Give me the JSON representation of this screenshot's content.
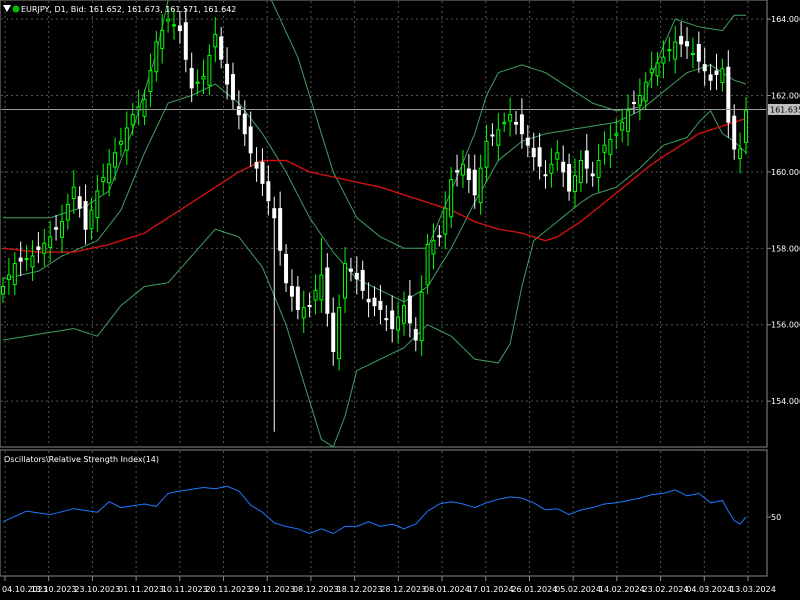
{
  "header": {
    "symbol_info": "EURJPY, D1, Bid:  161.652, 161.673, 161.571, 161.642",
    "triangle_icon": "triangle-down-icon",
    "status_icon": "green-dot-icon"
  },
  "colors": {
    "background": "#000000",
    "grid": "#4a5a52",
    "bull_candle": "#00ff00",
    "bear_candle": "#ffffff",
    "bollinger": "#3f9f5f",
    "moving_average": "#d01010",
    "rsi_line": "#1e78ff",
    "price_line": "#8a8a8a",
    "current_price_box": "#c0c0c0"
  },
  "rsi_panel": {
    "title": "Oscillators\\Relative Strength Index(14)",
    "level_label": "50"
  },
  "current_price": {
    "label": "161.635",
    "value": 161.635
  },
  "x_axis_labels": [
    "04.10.2023",
    "13.10.2023",
    "23.10.2023",
    "01.11.2023",
    "10.11.2023",
    "20.11.2023",
    "29.11.2023",
    "08.12.2023",
    "18.12.2023",
    "28.12.2023",
    "08.01.2024",
    "17.01.2024",
    "26.01.2024",
    "05.02.2024",
    "14.02.2024",
    "23.02.2024",
    "04.03.2024",
    "13.03.2024"
  ],
  "chart_data": [
    {
      "type": "candlestick",
      "title": "EURJPY, D1",
      "y_ticks": [
        154.0,
        156.0,
        158.0,
        160.0,
        162.0,
        164.0
      ],
      "ylim": [
        152.8,
        164.5
      ],
      "grid": true,
      "anchors": {
        "price": [
          [
            0,
            157.0
          ],
          [
            2,
            157.6
          ],
          [
            5,
            157.8
          ],
          [
            8,
            158.3
          ],
          [
            10,
            158.7
          ],
          [
            12,
            159.6
          ],
          [
            14,
            158.5
          ],
          [
            16,
            159.5
          ],
          [
            18,
            160.2
          ],
          [
            20,
            160.8
          ],
          [
            22,
            161.5
          ],
          [
            24,
            161.9
          ],
          [
            26,
            163.4
          ],
          [
            28,
            164.0
          ],
          [
            30,
            163.7
          ],
          [
            32,
            162.2
          ],
          [
            34,
            162.5
          ],
          [
            36,
            163.6
          ],
          [
            38,
            162.3
          ],
          [
            40,
            161.5
          ],
          [
            42,
            160.5
          ],
          [
            44,
            159.7
          ],
          [
            46,
            158.8
          ],
          [
            48,
            157.1
          ],
          [
            50,
            156.4
          ],
          [
            52,
            156.5
          ],
          [
            54,
            157.3
          ],
          [
            56,
            155.3
          ],
          [
            58,
            157.6
          ],
          [
            60,
            157.2
          ],
          [
            62,
            156.6
          ],
          [
            64,
            156.4
          ],
          [
            66,
            155.9
          ],
          [
            68,
            156.5
          ],
          [
            70,
            155.6
          ],
          [
            72,
            158.1
          ],
          [
            74,
            158.3
          ],
          [
            76,
            159.8
          ],
          [
            78,
            160.2
          ],
          [
            80,
            159.4
          ],
          [
            82,
            160.8
          ],
          [
            84,
            161.1
          ],
          [
            86,
            161.5
          ],
          [
            88,
            161.0
          ],
          [
            90,
            160.4
          ],
          [
            92,
            159.9
          ],
          [
            94,
            160.5
          ],
          [
            96,
            159.5
          ],
          [
            98,
            160.3
          ],
          [
            100,
            159.9
          ],
          [
            102,
            160.7
          ],
          [
            104,
            161.0
          ],
          [
            106,
            161.6
          ],
          [
            108,
            162.0
          ],
          [
            110,
            162.7
          ],
          [
            112,
            163.0
          ],
          [
            114,
            163.4
          ],
          [
            116,
            163.3
          ],
          [
            118,
            162.9
          ],
          [
            120,
            162.4
          ],
          [
            122,
            162.7
          ],
          [
            123,
            161.3
          ],
          [
            124,
            160.6
          ],
          [
            125,
            160.6
          ],
          [
            126,
            161.6
          ]
        ],
        "bollinger_upper": [
          [
            0,
            158.8
          ],
          [
            8,
            158.8
          ],
          [
            14,
            159.1
          ],
          [
            18,
            159.5
          ],
          [
            22,
            161.1
          ],
          [
            26,
            163.1
          ],
          [
            28,
            164.5
          ],
          [
            32,
            166.0
          ],
          [
            36,
            166.5
          ],
          [
            40,
            166.0
          ],
          [
            44,
            165.0
          ],
          [
            50,
            163.0
          ],
          [
            56,
            160.0
          ],
          [
            60,
            158.8
          ],
          [
            64,
            158.3
          ],
          [
            68,
            158.0
          ],
          [
            72,
            158.0
          ],
          [
            76,
            159.5
          ],
          [
            80,
            161.0
          ],
          [
            82,
            162.0
          ],
          [
            84,
            162.6
          ],
          [
            88,
            162.8
          ],
          [
            92,
            162.6
          ],
          [
            96,
            162.2
          ],
          [
            100,
            161.8
          ],
          [
            104,
            161.6
          ],
          [
            108,
            161.7
          ],
          [
            110,
            162.5
          ],
          [
            112,
            163.3
          ],
          [
            114,
            164.0
          ],
          [
            118,
            163.8
          ],
          [
            122,
            163.7
          ],
          [
            124,
            164.1
          ],
          [
            126,
            164.1
          ]
        ],
        "bollinger_middle": [
          [
            0,
            157.2
          ],
          [
            6,
            157.4
          ],
          [
            10,
            157.8
          ],
          [
            16,
            158.2
          ],
          [
            20,
            159.0
          ],
          [
            24,
            160.5
          ],
          [
            28,
            161.8
          ],
          [
            32,
            162.0
          ],
          [
            36,
            162.3
          ],
          [
            40,
            161.8
          ],
          [
            44,
            161.0
          ],
          [
            48,
            160.0
          ],
          [
            52,
            158.8
          ],
          [
            56,
            157.9
          ],
          [
            60,
            157.2
          ],
          [
            64,
            156.9
          ],
          [
            68,
            156.6
          ],
          [
            72,
            157.0
          ],
          [
            76,
            158.0
          ],
          [
            80,
            159.2
          ],
          [
            84,
            160.3
          ],
          [
            88,
            160.8
          ],
          [
            92,
            161.0
          ],
          [
            96,
            161.1
          ],
          [
            100,
            161.2
          ],
          [
            104,
            161.3
          ],
          [
            108,
            161.6
          ],
          [
            112,
            162.1
          ],
          [
            116,
            162.6
          ],
          [
            120,
            162.8
          ],
          [
            124,
            162.4
          ],
          [
            126,
            162.3
          ]
        ],
        "bollinger_lower": [
          [
            0,
            155.6
          ],
          [
            8,
            155.8
          ],
          [
            12,
            155.9
          ],
          [
            16,
            155.7
          ],
          [
            20,
            156.5
          ],
          [
            24,
            157.0
          ],
          [
            28,
            157.1
          ],
          [
            32,
            157.8
          ],
          [
            36,
            158.5
          ],
          [
            40,
            158.3
          ],
          [
            44,
            157.5
          ],
          [
            48,
            156.0
          ],
          [
            52,
            154.0
          ],
          [
            54,
            153.0
          ],
          [
            56,
            152.8
          ],
          [
            58,
            153.6
          ],
          [
            60,
            154.8
          ],
          [
            64,
            155.1
          ],
          [
            68,
            155.4
          ],
          [
            72,
            156.0
          ],
          [
            76,
            155.7
          ],
          [
            80,
            155.1
          ],
          [
            84,
            155.0
          ],
          [
            86,
            155.5
          ],
          [
            88,
            157.0
          ],
          [
            90,
            158.2
          ],
          [
            94,
            158.7
          ],
          [
            98,
            159.2
          ],
          [
            100,
            159.4
          ],
          [
            104,
            159.6
          ],
          [
            108,
            160.1
          ],
          [
            112,
            160.7
          ],
          [
            116,
            160.9
          ],
          [
            118,
            161.3
          ],
          [
            120,
            161.6
          ],
          [
            122,
            161.0
          ],
          [
            124,
            160.8
          ],
          [
            126,
            160.5
          ]
        ],
        "moving_average": [
          [
            0,
            158.0
          ],
          [
            6,
            157.9
          ],
          [
            12,
            157.9
          ],
          [
            18,
            158.1
          ],
          [
            24,
            158.4
          ],
          [
            28,
            158.8
          ],
          [
            32,
            159.2
          ],
          [
            36,
            159.6
          ],
          [
            40,
            160.0
          ],
          [
            44,
            160.3
          ],
          [
            48,
            160.3
          ],
          [
            52,
            160.0
          ],
          [
            58,
            159.8
          ],
          [
            64,
            159.6
          ],
          [
            70,
            159.3
          ],
          [
            76,
            159.0
          ],
          [
            80,
            158.7
          ],
          [
            84,
            158.5
          ],
          [
            88,
            158.4
          ],
          [
            92,
            158.2
          ],
          [
            94,
            158.3
          ],
          [
            98,
            158.7
          ],
          [
            102,
            159.2
          ],
          [
            106,
            159.7
          ],
          [
            110,
            160.2
          ],
          [
            114,
            160.6
          ],
          [
            118,
            161.0
          ],
          [
            122,
            161.2
          ],
          [
            126,
            161.4
          ]
        ],
        "rsi": [
          [
            0,
            46
          ],
          [
            4,
            55
          ],
          [
            8,
            52
          ],
          [
            12,
            57
          ],
          [
            16,
            54
          ],
          [
            18,
            63
          ],
          [
            20,
            58
          ],
          [
            24,
            61
          ],
          [
            26,
            59
          ],
          [
            28,
            70
          ],
          [
            30,
            72
          ],
          [
            34,
            75
          ],
          [
            36,
            74
          ],
          [
            38,
            76
          ],
          [
            40,
            72
          ],
          [
            42,
            60
          ],
          [
            44,
            54
          ],
          [
            46,
            45
          ],
          [
            48,
            42
          ],
          [
            50,
            40
          ],
          [
            52,
            36
          ],
          [
            54,
            40
          ],
          [
            56,
            36
          ],
          [
            58,
            42
          ],
          [
            60,
            42
          ],
          [
            62,
            46
          ],
          [
            64,
            42
          ],
          [
            66,
            44
          ],
          [
            68,
            40
          ],
          [
            70,
            44
          ],
          [
            72,
            55
          ],
          [
            74,
            61
          ],
          [
            76,
            63
          ],
          [
            78,
            61
          ],
          [
            80,
            58
          ],
          [
            82,
            62
          ],
          [
            84,
            65
          ],
          [
            86,
            67
          ],
          [
            88,
            66
          ],
          [
            90,
            62
          ],
          [
            92,
            56
          ],
          [
            94,
            57
          ],
          [
            96,
            52
          ],
          [
            98,
            56
          ],
          [
            100,
            58
          ],
          [
            102,
            61
          ],
          [
            104,
            62
          ],
          [
            106,
            64
          ],
          [
            108,
            66
          ],
          [
            110,
            69
          ],
          [
            112,
            70
          ],
          [
            114,
            73
          ],
          [
            116,
            68
          ],
          [
            118,
            70
          ],
          [
            120,
            62
          ],
          [
            122,
            64
          ],
          [
            123,
            55
          ],
          [
            124,
            47
          ],
          [
            125,
            44
          ],
          [
            126,
            50
          ]
        ]
      },
      "first_bar_label": "04.10.2023",
      "last_bar_label": "13.03.2024"
    },
    {
      "type": "line",
      "title": "Oscillators\\Relative Strength Index(14)",
      "levels": [
        50
      ],
      "ylim": [
        0,
        100
      ]
    }
  ]
}
